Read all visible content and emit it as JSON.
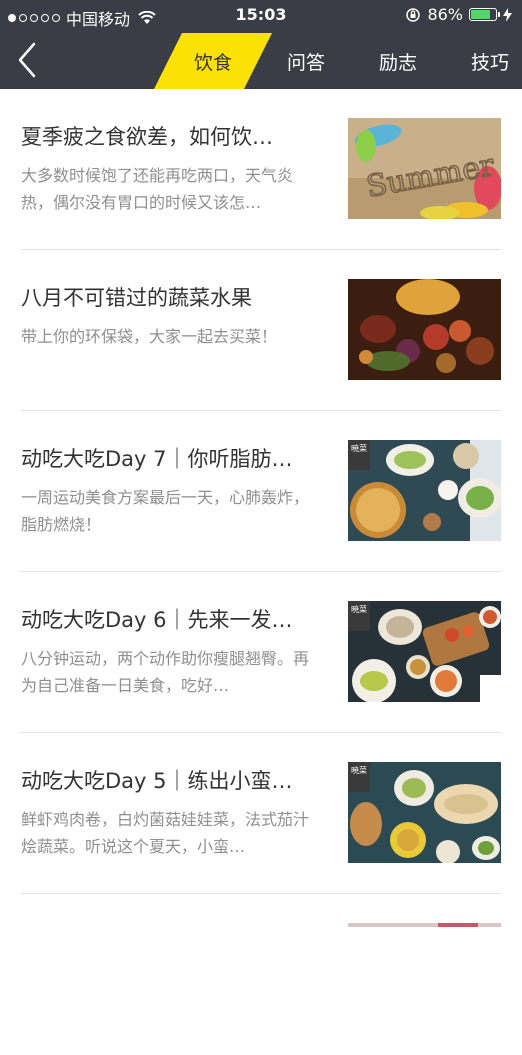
{
  "status_bar": {
    "carrier": "中国移动",
    "time": "15:03",
    "battery": "86%",
    "battery_level": 0.86
  },
  "nav": {
    "back_icon": "chevron-left-icon",
    "tabs": [
      {
        "label": "饮食",
        "active": true
      },
      {
        "label": "问答",
        "active": false
      },
      {
        "label": "励志",
        "active": false
      },
      {
        "label": "技巧",
        "active": false
      }
    ],
    "accent_color": "#fbe204",
    "bar_color": "#3a3d45"
  },
  "articles": [
    {
      "title": "夏季疲之食欲差，如何饮…",
      "desc": "大多数时候饱了还能再吃两口，天气炎热，偶尔没有胃口的时候又该怎…",
      "thumb_text": "Summer"
    },
    {
      "title": "八月不可错过的蔬菜水果",
      "desc": "带上你的环保袋，大家一起去买菜！",
      "thumb_text": ""
    },
    {
      "title": "动吃大吃Day 7｜你听脂肪…",
      "desc": "一周运动美食方案最后一天，心肺轰炸，脂肪燃烧！",
      "thumb_text": "暁菜"
    },
    {
      "title": "动吃大吃Day 6｜先来一发…",
      "desc": "八分钟运动，两个动作助你瘦腿翘臀。再为自己准备一日美食，吃好…",
      "thumb_text": "暁菜"
    },
    {
      "title": "动吃大吃Day 5｜练出小蛮…",
      "desc": "鲜虾鸡肉卷，白灼菌菇娃娃菜，法式茄汁烩蔬菜。听说这个夏天，小蛮…",
      "thumb_text": "暁菜"
    }
  ]
}
